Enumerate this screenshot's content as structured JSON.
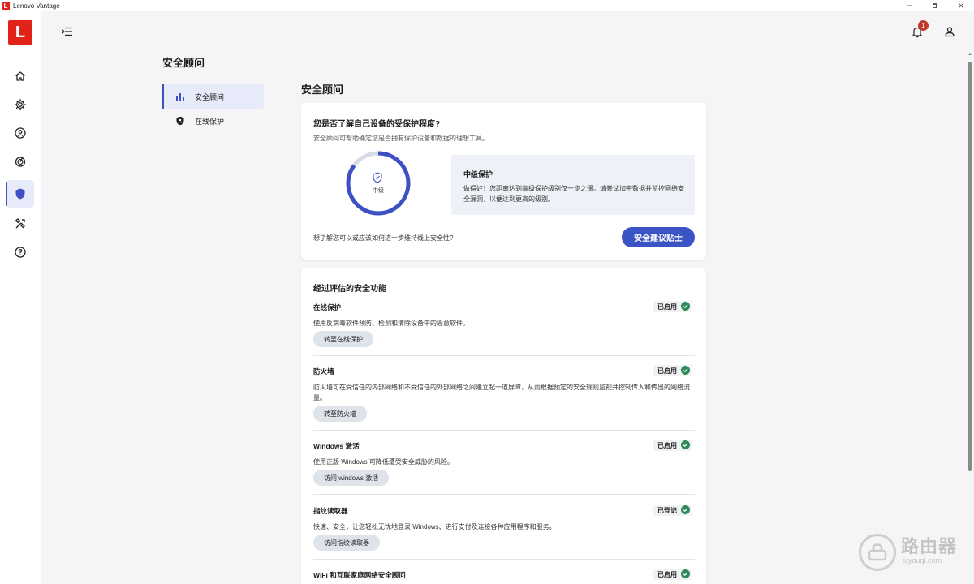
{
  "window": {
    "title": "Lenovo Vantage",
    "logo_letter": "L"
  },
  "rail": {
    "brand_letter": "L",
    "items": [
      {
        "icon": "home-icon"
      },
      {
        "icon": "gear-icon"
      },
      {
        "icon": "account-icon"
      },
      {
        "icon": "radar-icon"
      },
      {
        "icon": "shield-icon",
        "active": true
      },
      {
        "icon": "tools-icon"
      },
      {
        "icon": "help-icon"
      }
    ]
  },
  "topbar": {
    "notification_count": "1"
  },
  "subnav": {
    "title": "安全顾问",
    "items": [
      {
        "label": "安全顾问",
        "icon": "bar-chart-icon",
        "active": true
      },
      {
        "label": "在线保护",
        "icon": "shield-icon"
      }
    ]
  },
  "main": {
    "title": "安全顾问",
    "overview": {
      "title": "您是否了解自己设备的受保护程度?",
      "description": "安全顾问可帮助确定您是否拥有保护设备和数据的理想工具。",
      "ring_label": "中级",
      "ring_progress": 0.85,
      "level_title": "中级保护",
      "level_description": "做得好！您距离达到高级保护级别仅一步之遥。请尝试加密数据并监控网络安全漏洞，以便达到更高的级别。",
      "question": "想了解您可以或应该如何进一步维持线上安全性?",
      "tips_button": "安全建议贴士"
    },
    "features": {
      "title": "经过评估的安全功能",
      "items": [
        {
          "name": "在线保护",
          "status": "已启用",
          "description": "使用反病毒软件预防、检测和清除设备中的恶意软件。",
          "button": "转至在线保护"
        },
        {
          "name": "防火墙",
          "status": "已启用",
          "description": "防火墙可在受信任的内部网络和不受信任的外部网络之间建立起一道屏障，从而根据预定的安全规则监视并控制传入和传出的网络流量。",
          "button": "转至防火墙"
        },
        {
          "name": "Windows 激活",
          "status": "已启用",
          "description": "使用正版 Windows 可降低遭受安全威胁的风险。",
          "button": "访问 windows 激活"
        },
        {
          "name": "指纹读取器",
          "status": "已登记",
          "description": "快速、安全，让您轻松无忧地登录 Windows、进行支付及连接各种应用程序和服务。",
          "button": "访问指纹读取器"
        },
        {
          "name": "WiFi 和互联家庭网络安全顾问",
          "status": "已启用",
          "description": "",
          "button": ""
        }
      ]
    }
  },
  "watermark": {
    "text": "路由器",
    "url": "luyouqi.com"
  },
  "colors": {
    "accent": "#3a53c5",
    "ring": "#3d51c4",
    "brand": "#e2231a",
    "success": "#2e8b57"
  }
}
